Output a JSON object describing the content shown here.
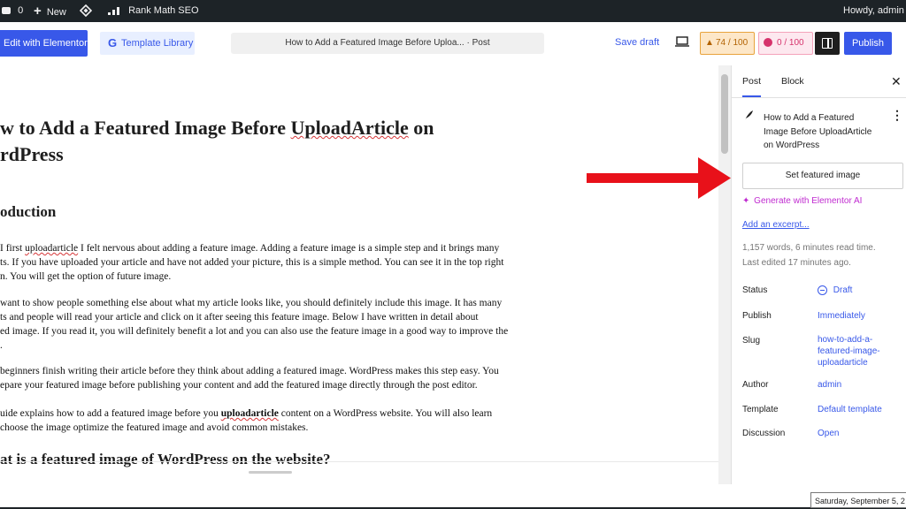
{
  "admin_bar": {
    "comments_count": "0",
    "new_label": "New",
    "rank_math_label": "Rank Math SEO",
    "howdy": "Howdy, admin"
  },
  "header": {
    "elementor_button": "Edit with Elementor",
    "template_library": "Template Library",
    "document_title": "How to Add a Featured Image Before Uploa... · Post",
    "save_draft": "Save draft",
    "rank_math_score": "74 / 100",
    "readability_score": "0 / 100",
    "publish": "Publish"
  },
  "content": {
    "title_line1_a": "w to Add a Featured Image Before ",
    "title_line1_b": "UploadArticle",
    "title_line1_c": " on",
    "title_line2": "rdPress",
    "heading_intro": "oduction",
    "p1_l1_a": "I first ",
    "p1_l1_b": "uploadarticle",
    "p1_l1_c": " I felt nervous about adding a feature image. Adding a feature image is a simple step and it brings many",
    "p1_l2": "ts. If you have uploaded your article and have not added your picture, this is a simple method. You can see it in the top right",
    "p1_l3": "n. You will get the option of future image.",
    "p2_l1": "want to show people something else about what my article looks like, you should definitely include this image. It has many",
    "p2_l2": "ts and people will read your article and click on it after seeing this feature image. Below I have written in detail about",
    "p2_l3": "ed image. If you read it, you will definitely benefit a lot and you can also use the feature image in a good way to improve the",
    "p2_l4": ".",
    "p3_l1": "beginners finish writing their article before they think about adding a featured image. WordPress makes this step easy. You",
    "p3_l2": "epare your featured image before publishing your content and add the featured image directly through the post editor.",
    "p4_l1_a": "uide explains how to add a featured image before you ",
    "p4_l1_b": "uploadarticle",
    "p4_l1_c": " content on a WordPress website. You will also learn",
    "p4_l2": "choose the image optimize the featured image and avoid common mistakes.",
    "heading_what": "at is a featured image of WordPress on the website?"
  },
  "sidebar": {
    "tab_post": "Post",
    "tab_block": "Block",
    "post_title": [
      "How to Add a Featured",
      "Image Before UploadArticle",
      "on WordPress"
    ],
    "set_featured_image": "Set featured image",
    "generate_ai": "Generate with Elementor AI",
    "add_excerpt": "Add an excerpt...",
    "word_count": "1,157 words, 6 minutes read time.",
    "last_edited": "Last edited 17 minutes ago.",
    "status_label": "Status",
    "status_value": "Draft",
    "publish_label": "Publish",
    "publish_value": "Immediately",
    "slug_label": "Slug",
    "slug_value": [
      "how-to-add-a-",
      "featured-image-",
      "uploadarticle"
    ],
    "author_label": "Author",
    "author_value": "admin",
    "template_label": "Template",
    "template_value": "Default template",
    "discussion_label": "Discussion",
    "discussion_value": "Open"
  },
  "taskbar": {
    "date_tooltip": "Saturday, September 5, 2"
  },
  "colors": {
    "accent": "#3858e9",
    "admin_bar": "#1d2327",
    "arrow": "#e8111a",
    "ai_purple": "#c02bd0"
  }
}
